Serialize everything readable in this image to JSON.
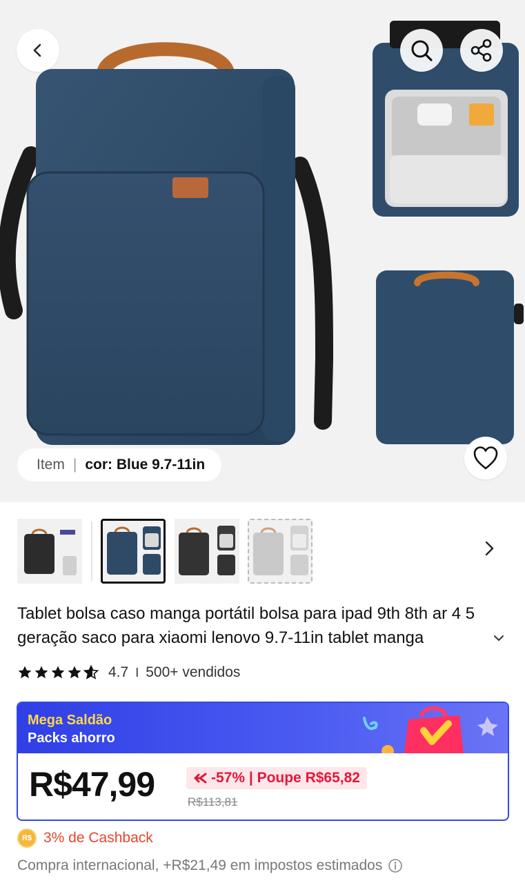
{
  "hero": {
    "variant_label": "Item",
    "variant_separator": "|",
    "variant_value": "cor: Blue 9.7-11in"
  },
  "icons": {
    "back": "chevron-left-icon",
    "search": "search-icon",
    "share": "share-icon",
    "favorite": "heart-icon",
    "next": "chevron-right-icon",
    "expand": "chevron-down-icon",
    "info": "info-icon"
  },
  "thumbnails": [
    {
      "color": "black"
    },
    {
      "color": "blue",
      "selected": true
    },
    {
      "color": "dark-gray"
    },
    {
      "color": "light-gray"
    }
  ],
  "product": {
    "title": "Tablet bolsa caso manga portátil bolsa para ipad 9th 8th ar 4 5 geração saco para xiaomi lenovo 9.7-11in tablet manga",
    "rating_value": "4.7",
    "rating_separator": "I",
    "sold": "500+ vendidos",
    "stars": 4.7
  },
  "promo": {
    "line1": "Mega Saldão",
    "line2": "Packs ahorro"
  },
  "price": {
    "current": "R$47,99",
    "discount": "-57% | Poupe R$65,82",
    "original": "R$113,81"
  },
  "cashback": {
    "coin_label": "R$",
    "text": "3% de Cashback"
  },
  "tax": {
    "text": "Compra internacional, +R$21,49 em impostos estimados"
  },
  "colors": {
    "accent_blue": "#3347e8",
    "promo_yellow": "#ffd94a",
    "discount_red": "#e4173a",
    "cashback_orange": "#e8452a",
    "bag_navy": "#2e4a66"
  }
}
